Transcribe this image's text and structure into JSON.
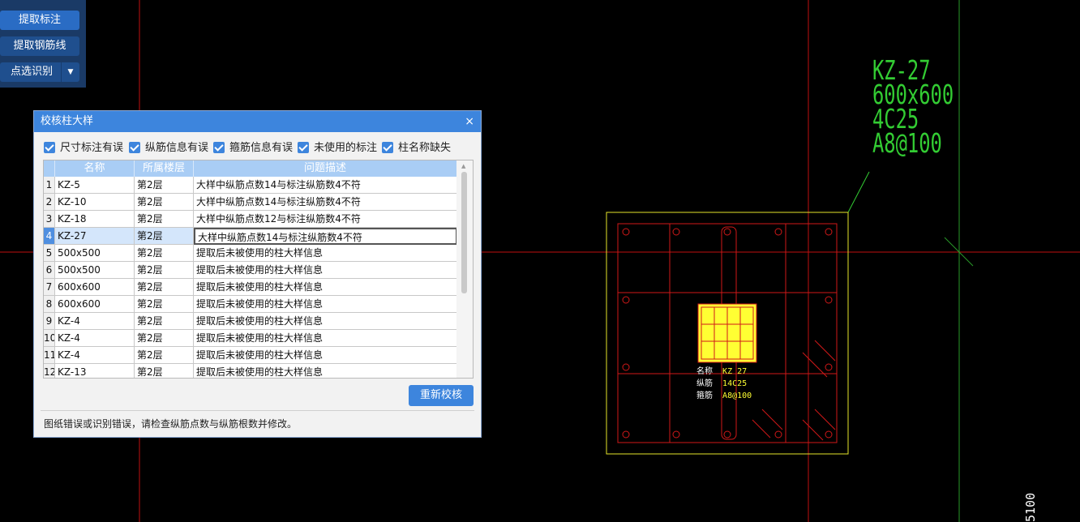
{
  "toolbar": {
    "buttons": [
      {
        "label": "提取标注",
        "active": true
      },
      {
        "label": "提取钢筋线",
        "active": false
      },
      {
        "label": "点选识别",
        "active": false,
        "dropdown": true
      }
    ]
  },
  "dialog": {
    "title": "校核柱大样",
    "close": "×",
    "filters": [
      {
        "label": "尺寸标注有误",
        "checked": true
      },
      {
        "label": "纵筋信息有误",
        "checked": true
      },
      {
        "label": "箍筋信息有误",
        "checked": true
      },
      {
        "label": "未使用的标注",
        "checked": true
      },
      {
        "label": "柱名称缺失",
        "checked": true
      }
    ],
    "columns": [
      "名称",
      "所属楼层",
      "问题描述"
    ],
    "rows": [
      {
        "n": "1",
        "name": "KZ-5",
        "floor": "第2层",
        "desc": "大样中纵筋点数14与标注纵筋数4不符"
      },
      {
        "n": "2",
        "name": "KZ-10",
        "floor": "第2层",
        "desc": "大样中纵筋点数14与标注纵筋数4不符"
      },
      {
        "n": "3",
        "name": "KZ-18",
        "floor": "第2层",
        "desc": "大样中纵筋点数12与标注纵筋数4不符"
      },
      {
        "n": "4",
        "name": "KZ-27",
        "floor": "第2层",
        "desc": "大样中纵筋点数14与标注纵筋数4不符",
        "selected": true
      },
      {
        "n": "5",
        "name": "500x500",
        "floor": "第2层",
        "desc": "提取后未被使用的柱大样信息"
      },
      {
        "n": "6",
        "name": "500x500",
        "floor": "第2层",
        "desc": "提取后未被使用的柱大样信息"
      },
      {
        "n": "7",
        "name": "600x600",
        "floor": "第2层",
        "desc": "提取后未被使用的柱大样信息"
      },
      {
        "n": "8",
        "name": "600x600",
        "floor": "第2层",
        "desc": "提取后未被使用的柱大样信息"
      },
      {
        "n": "9",
        "name": "KZ-4",
        "floor": "第2层",
        "desc": "提取后未被使用的柱大样信息"
      },
      {
        "n": "10",
        "name": "KZ-4",
        "floor": "第2层",
        "desc": "提取后未被使用的柱大样信息"
      },
      {
        "n": "11",
        "name": "KZ-4",
        "floor": "第2层",
        "desc": "提取后未被使用的柱大样信息"
      },
      {
        "n": "12",
        "name": "KZ-13",
        "floor": "第2层",
        "desc": "提取后未被使用的柱大样信息"
      }
    ],
    "recheck_label": "重新校核",
    "status": "图纸错误或识别错误，请检查纵筋点数与纵筋根数并修改。"
  },
  "drawing": {
    "annotation": [
      "KZ-27",
      "600x600",
      "4C25",
      "A8@100"
    ],
    "labels": [
      {
        "key": "名称",
        "val": "KZ 27"
      },
      {
        "key": "纵筋",
        "val": "14C25"
      },
      {
        "key": "箍筋",
        "val": "A8@100"
      }
    ],
    "edge_text": "5100"
  },
  "colors": {
    "accent": "#3d85dd",
    "cad_red": "#d01818",
    "cad_yellow": "#ffff33",
    "cad_green": "#33cc33"
  }
}
